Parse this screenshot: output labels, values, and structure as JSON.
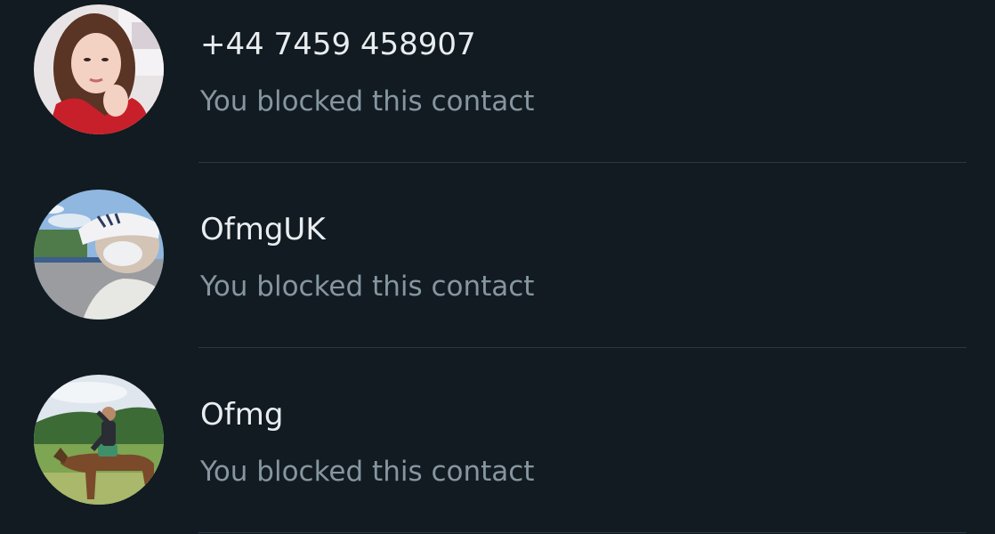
{
  "contacts": [
    {
      "name": "+44 7459 458907",
      "status": "You blocked this contact",
      "avatar_icon": "avatar-photo-woman"
    },
    {
      "name": "OfmgUK",
      "status": "You blocked this contact",
      "avatar_icon": "avatar-photo-person-cap"
    },
    {
      "name": "Ofmg",
      "status": "You blocked this contact",
      "avatar_icon": "avatar-photo-horse-rider"
    }
  ],
  "colors": {
    "background": "#111b21",
    "primary_text": "#e9edef",
    "secondary_text": "#8696a0",
    "divider": "#2a3942"
  }
}
